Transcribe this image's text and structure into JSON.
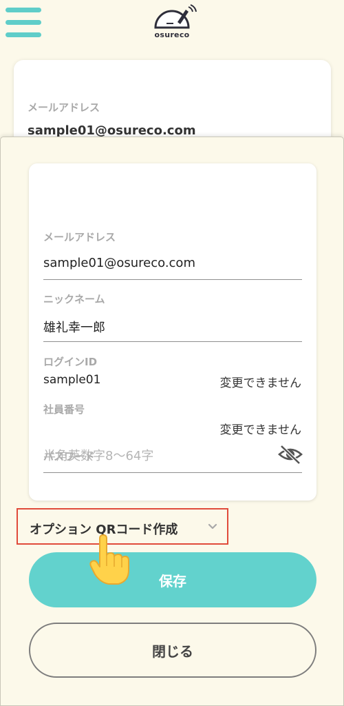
{
  "header": {
    "menu_icon": "hamburger-icon",
    "logo_text": "osureco"
  },
  "background_card": {
    "email_label": "メールアドレス",
    "email_value": "sample01@osureco.com"
  },
  "form": {
    "email_label": "メールアドレス",
    "email_value": "sample01@osureco.com",
    "nickname_label": "ニックネーム",
    "nickname_value": "雄礼幸一郎",
    "login_id_label": "ログインID",
    "login_id_value": "sample01",
    "login_id_note": "変更できません",
    "employee_no_label": "社員番号",
    "employee_no_note": "変更できません",
    "password_label": "パスワード",
    "password_placeholder": "半角英数字8〜64字",
    "password_toggle_icon": "eye-slash-icon"
  },
  "option": {
    "label": "オプション QRコード作成",
    "icon": "chevron-down-icon"
  },
  "pointer_icon": "hand-pointer-icon",
  "buttons": {
    "save": "保存",
    "close": "閉じる"
  },
  "colors": {
    "accent": "#62d2cd",
    "background": "#fcf9ea",
    "highlight_border": "#e04a3a"
  }
}
